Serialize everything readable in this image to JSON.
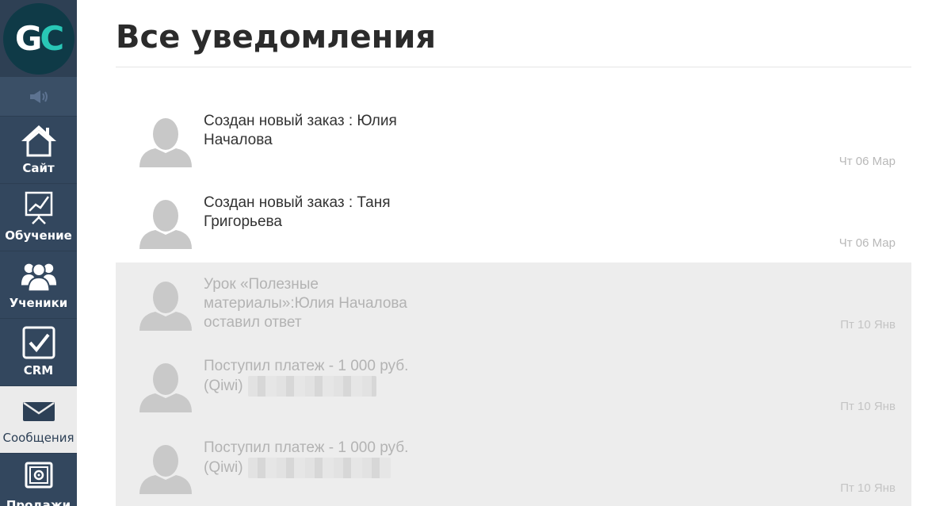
{
  "sidebar": {
    "logo_g": "G",
    "logo_c": "C",
    "speaker_icon": "speaker-icon",
    "items": [
      {
        "label": "Сайт",
        "icon": "house-icon",
        "active": false
      },
      {
        "label": "Обучение",
        "icon": "presentation-chart-icon",
        "active": false
      },
      {
        "label": "Ученики",
        "icon": "users-icon",
        "active": false
      },
      {
        "label": "CRM",
        "icon": "checkbox-icon",
        "active": false
      },
      {
        "label": "Сообщения",
        "icon": "envelope-icon",
        "active": true
      },
      {
        "label": "Продажи",
        "icon": "safe-icon",
        "active": false
      }
    ]
  },
  "main": {
    "title": "Все уведомления"
  },
  "notifications": [
    {
      "text": "Создан новый заказ : Юлия Началова",
      "date": "Чт 06 Мар",
      "read": false
    },
    {
      "text": "Создан новый заказ : Таня Григорьева",
      "date": "Чт 06 Мар",
      "read": false
    },
    {
      "text": "Урок «Полезные материалы»:Юлия Началова оставил ответ",
      "date": "Пт 10 Янв",
      "read": true
    },
    {
      "text": "Поступил платеж - 1 000 руб. (Qiwi)",
      "date": "Пт 10 Янв",
      "read": true
    },
    {
      "text": "Поступил платеж - 1 000 руб. (Qiwi)",
      "date": "Пт 10 Янв",
      "read": true
    }
  ],
  "colors": {
    "sidebar_bg": "#33475e",
    "logo_accent": "#29c7b6",
    "read_bg": "#ededed"
  }
}
